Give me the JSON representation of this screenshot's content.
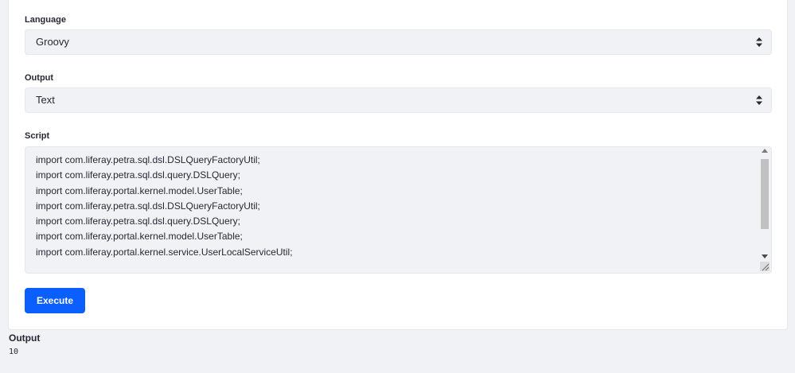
{
  "form": {
    "language": {
      "label": "Language",
      "selected": "Groovy"
    },
    "output": {
      "label": "Output",
      "selected": "Text"
    },
    "script": {
      "label": "Script",
      "lines": [
        "import com.liferay.petra.sql.dsl.DSLQueryFactoryUtil;",
        "import com.liferay.petra.sql.dsl.query.DSLQuery;",
        "import com.liferay.portal.kernel.model.UserTable;",
        "import com.liferay.petra.sql.dsl.DSLQueryFactoryUtil;",
        "import com.liferay.petra.sql.dsl.query.DSLQuery;",
        "import com.liferay.portal.kernel.model.UserTable;",
        "import com.liferay.portal.kernel.service.UserLocalServiceUtil;"
      ]
    },
    "execute_label": "Execute"
  },
  "result": {
    "heading": "Output",
    "value": "10"
  },
  "icons": {
    "select_caret": "caret-double-icon",
    "resize": "resize-grip-icon"
  },
  "colors": {
    "primary": "#0b5fff",
    "page_bg": "#f1f2f5",
    "input_bg": "#f1f2f5",
    "text": "#272833"
  }
}
